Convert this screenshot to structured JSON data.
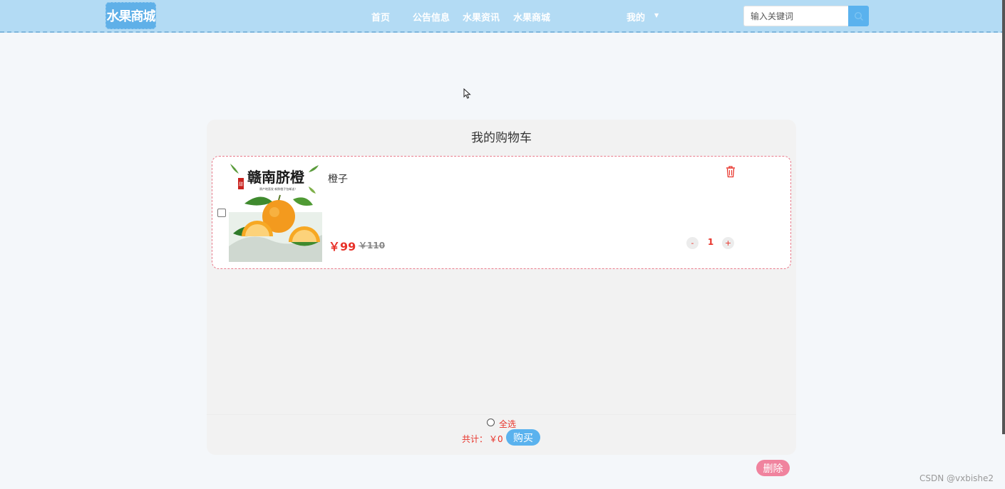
{
  "header": {
    "logo": "水果商城",
    "nav": [
      {
        "label": "首页"
      },
      {
        "label": "公告信息"
      },
      {
        "label": "水果资讯"
      },
      {
        "label": "水果商城"
      },
      {
        "label": "我的"
      }
    ],
    "search": {
      "placeholder": "输入关键词",
      "value": ""
    }
  },
  "cart": {
    "title": "我的购物车",
    "items": [
      {
        "name": "橙子",
        "price": "￥99",
        "original_price": "￥110",
        "quantity": "1",
        "minus_label": "-",
        "plus_label": "+",
        "checked": false,
        "image": {
          "headline": "赣南脐橙",
          "stamp": "甜",
          "subtext": "原产地直发 新鲜橙子包邮送！"
        }
      }
    ],
    "footer": {
      "select_all_label": "全选",
      "total_label": "共计：",
      "total_value": "￥0",
      "buy_label": "购买"
    }
  },
  "delete_label": "删除",
  "watermark": "CSDN @vxbishe2",
  "colors": {
    "nav_bg": "#b3dbf4",
    "accent_blue": "#5ab2ee",
    "price_red": "#e8332a",
    "delete_pink": "#f0839e"
  }
}
